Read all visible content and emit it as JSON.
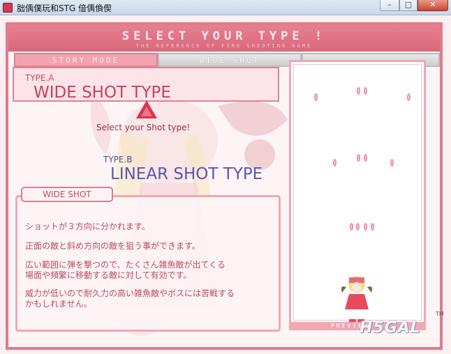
{
  "window": {
    "title": "朏偊僕玩和STG 偣偊偩偰",
    "buttons": {
      "minimize": "–",
      "maximize": "□",
      "close": "✕"
    }
  },
  "header": {
    "title": "SELECT YOUR TYPE !",
    "subtitle": "THE REFERENCE OF FIRE SHOOTING GAME"
  },
  "tabs": [
    {
      "label": "STORY MODE",
      "active": true
    },
    {
      "label": "WIDE SHOT",
      "active": false
    },
    {
      "label": "",
      "active": false
    }
  ],
  "type_a": {
    "label": "TYPE.A",
    "name": "WIDE SHOT TYPE"
  },
  "select_hint": "Select your Shot type!",
  "type_b": {
    "label": "TYPE.B",
    "name": "LINEAR SHOT TYPE"
  },
  "description": {
    "label": "WIDE SHOT",
    "lines": [
      "ショットが３方向に分かれます。",
      "正面の敵と斜め方向の敵を狙う事ができます。",
      "広い範囲に弾を撃つので、たくさん雑魚敵が出てくる",
      "場面や頻繁に移動する敵に対して有効です。",
      "威力が低いので耐久力の高い雑魚敵やボスには苦戦する",
      "かもしれません。"
    ]
  },
  "preview": {
    "label": "PREVIEW"
  },
  "watermark": {
    "text": "H5GAL",
    "mark": "TM"
  },
  "colors": {
    "accent": "#e07b8c",
    "type_a": "#c9405a",
    "type_b": "#5a54b8",
    "close": "#c8452f"
  },
  "icons": {
    "app": "game-app-icon",
    "arrow": "up-triangle-arrow-icon"
  }
}
